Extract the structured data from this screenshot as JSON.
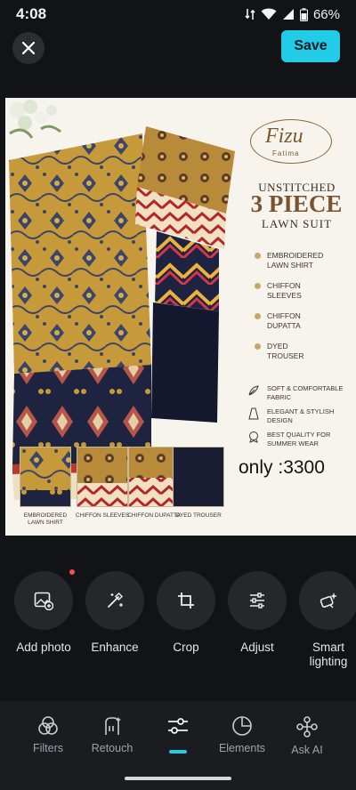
{
  "status_bar": {
    "time": "4:08",
    "battery": "66%"
  },
  "toolbar": {
    "save_label": "Save"
  },
  "photo": {
    "brand_name": "Fizu",
    "brand_sub": "Fatima",
    "headline_top": "UNSTITCHED",
    "headline_main": "3 PIECE",
    "headline_bottom": "LAWN SUIT",
    "features": [
      "EMBROIDERED\nLAWN SHIRT",
      "CHIFFON\nSLEEVES",
      "CHIFFON\nDUPATTA",
      "DYED\nTROUSER"
    ],
    "qualities": [
      "SOFT & COMFORTABLE\nFABRIC",
      "ELEGANT & STYLISH\nDESIGN",
      "BEST QUALITY FOR\nSUMMER WEAR"
    ],
    "thumbnails": [
      "EMBROIDERED LAWN\nSHIRT",
      "CHIFFON\nSLEEVES",
      "CHIFFON\nDUPATTA",
      "DYED\nTROUSER"
    ],
    "price_text": "only :3300"
  },
  "tools": [
    {
      "label": "Add photo",
      "icon": "add-photo-icon"
    },
    {
      "label": "Enhance",
      "icon": "magic-wand-icon"
    },
    {
      "label": "Crop",
      "icon": "crop-icon"
    },
    {
      "label": "Adjust",
      "icon": "sliders-icon"
    },
    {
      "label": "Smart\nlighting",
      "icon": "smart-lighting-icon"
    }
  ],
  "nav": [
    {
      "label": "Filters",
      "icon": "filters-icon"
    },
    {
      "label": "Retouch",
      "icon": "retouch-icon"
    },
    {
      "label": "",
      "icon": "adjust-icon",
      "active": true
    },
    {
      "label": "Elements",
      "icon": "elements-icon"
    },
    {
      "label": "Ask AI",
      "icon": "ask-ai-icon"
    }
  ],
  "colors": {
    "accent": "#22cce6",
    "background": "#121316",
    "notification": "#ff4b4b"
  }
}
